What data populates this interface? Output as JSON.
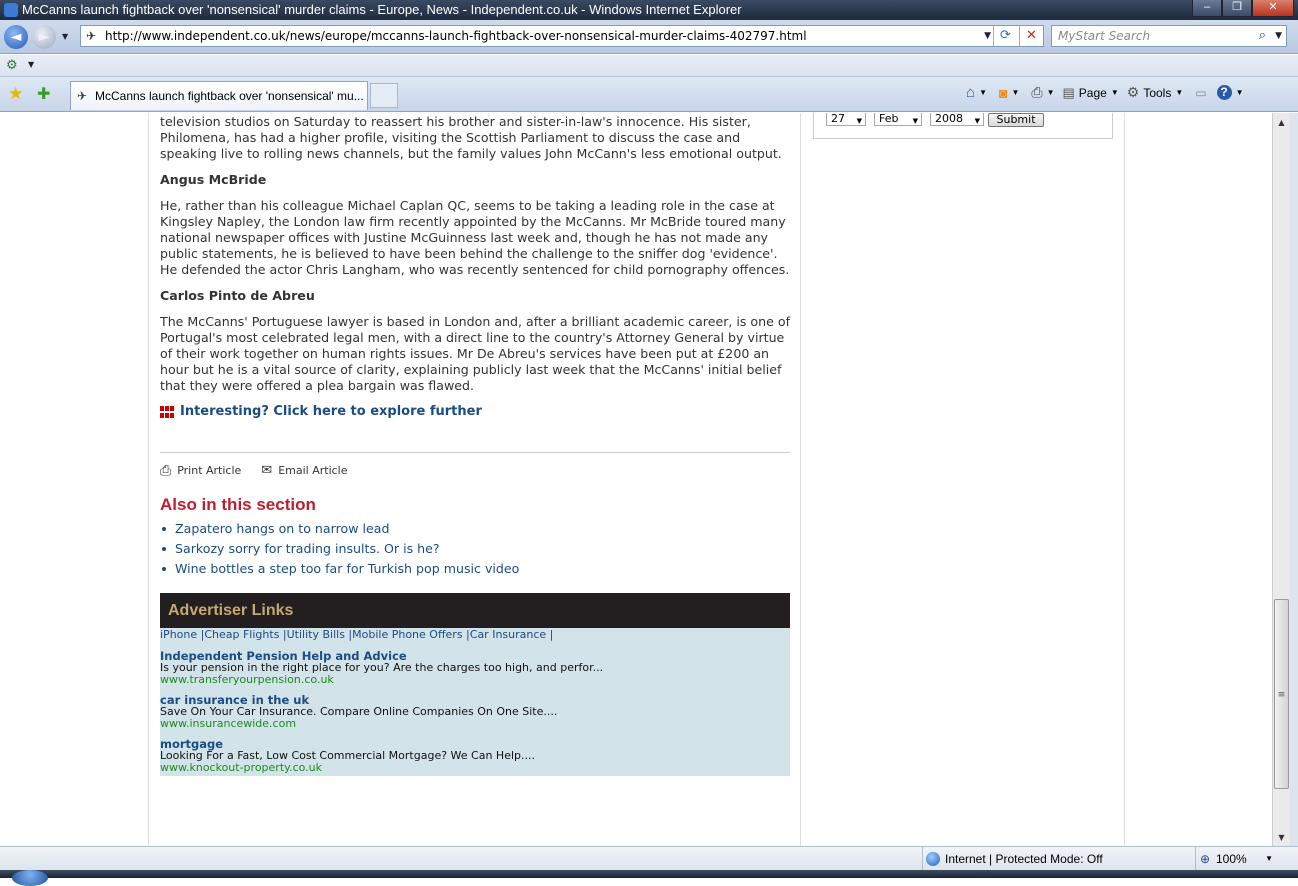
{
  "window": {
    "title": "McCanns launch fightback over 'nonsensical' murder claims - Europe, News - Independent.co.uk - Windows Internet Explorer",
    "minimize": "–",
    "restore": "❐",
    "close": "✕"
  },
  "addressbar": {
    "back": "◄",
    "forward": "►",
    "url": "http://www.independent.co.uk/news/europe/mccanns-launch-fightback-over-nonsensical-murder-claims-402797.html",
    "search_placeholder": "MyStart Search"
  },
  "tab": {
    "label": "McCanns launch fightback over 'nonsensical' mu..."
  },
  "command_bar": {
    "page": "Page",
    "tools": "Tools"
  },
  "date_picker": {
    "day": "27",
    "month": "Feb",
    "year": "2008",
    "submit": "Submit"
  },
  "article": {
    "intro_paragraph": "television studios on Saturday to reassert his brother and sister-in-law's innocence. His sister, Philomena, has had a higher profile, visiting the Scottish Parliament to discuss the case and speaking live to rolling news channels, but the family values John McCann's less emotional output.",
    "sections": [
      {
        "heading": "Angus McBride",
        "text": "He, rather than his colleague Michael Caplan QC, seems to be taking a leading role in the case at Kingsley Napley, the London law firm recently appointed by the McCanns. Mr McBride toured many national newspaper offices with Justine McGuinness last week and, though he has not made any public statements, he is believed to have been behind the challenge to the sniffer dog 'evidence'. He defended the actor Chris Langham, who was recently sentenced for child pornography offences."
      },
      {
        "heading": "Carlos Pinto de Abreu",
        "text": "The McCanns' Portuguese lawyer is based in London and, after a brilliant academic career, is one of Portugal's most celebrated legal men, with a direct line to the country's Attorney General by virtue of their work together on human rights issues. Mr De Abreu's services have been put at £200 an hour but he is a vital source of clarity, explaining publicly last week that the McCanns' initial belief that they were offered a plea bargain was flawed."
      }
    ],
    "explore_link": "Interesting? Click here to explore further",
    "print_label": "Print Article",
    "email_label": "Email Article"
  },
  "also_in_section": {
    "heading": "Also in this section",
    "items": [
      "Zapatero hangs on to narrow lead",
      "Sarkozy sorry for trading insults. Or is he?",
      "Wine bottles a step too far for Turkish pop music video"
    ]
  },
  "advertiser": {
    "heading": "Advertiser Links",
    "topics": [
      "iPhone",
      "Cheap Flights",
      "Utility Bills",
      "Mobile Phone Offers",
      "Car Insurance"
    ],
    "ads": [
      {
        "title": "Independent Pension Help and Advice",
        "desc": "Is your pension in the right place for you? Are the charges too high, and perfor...",
        "url": "www.transferyourpension.co.uk"
      },
      {
        "title": "car insurance in the uk",
        "desc": "Save On Your Car Insurance. Compare Online Companies On One Site....",
        "url": "www.insurancewide.com"
      },
      {
        "title": "mortgage",
        "desc": "Looking For a Fast, Low Cost Commercial Mortgage? We Can Help....",
        "url": "www.knockout-property.co.uk"
      }
    ]
  },
  "status": {
    "zone": "Internet | Protected Mode: Off",
    "zoom": "100%"
  }
}
